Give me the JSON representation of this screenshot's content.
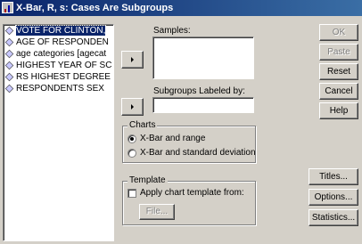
{
  "window": {
    "title": "X-Bar, R, s: Cases Are Subgroups"
  },
  "variables": [
    {
      "label": "VOTE FOR CLINTON,",
      "selected": true
    },
    {
      "label": "AGE OF RESPONDEN",
      "selected": false
    },
    {
      "label": "age categories [agecat",
      "selected": false
    },
    {
      "label": "HIGHEST YEAR OF SC",
      "selected": false
    },
    {
      "label": "RS HIGHEST DEGREE",
      "selected": false
    },
    {
      "label": "RESPONDENTS SEX",
      "selected": false
    }
  ],
  "samples": {
    "label": "Samples:"
  },
  "subgroups": {
    "label": "Subgroups Labeled by:"
  },
  "charts_group": {
    "title": "Charts",
    "options": [
      {
        "label": "X-Bar and range",
        "checked": true
      },
      {
        "label": "X-Bar and standard deviation",
        "checked": false
      }
    ]
  },
  "template_group": {
    "title": "Template",
    "apply_label": "Apply chart template from:",
    "file_button": "File..."
  },
  "buttons": {
    "ok": "OK",
    "paste": "Paste",
    "reset": "Reset",
    "cancel": "Cancel",
    "help": "Help",
    "titles": "Titles...",
    "options": "Options...",
    "statistics": "Statistics..."
  }
}
